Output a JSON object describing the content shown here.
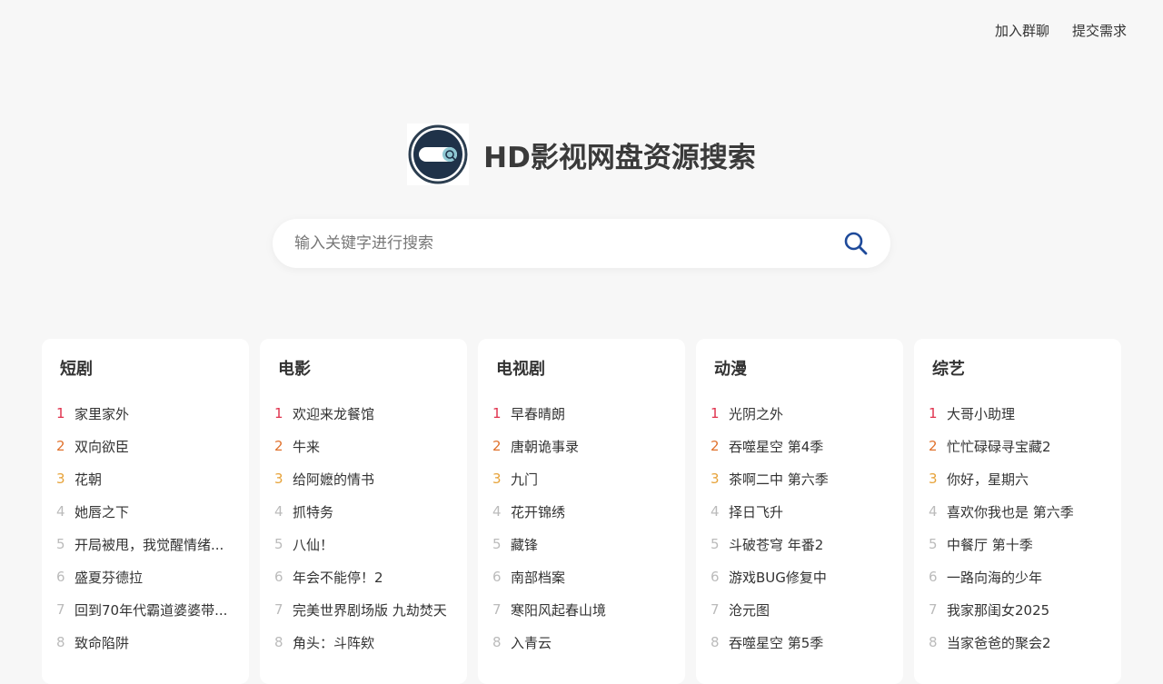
{
  "nav": {
    "join_group": "加入群聊",
    "submit_request": "提交需求"
  },
  "site": {
    "title": "HD影视网盘资源搜索"
  },
  "search": {
    "placeholder": "输入关键字进行搜索"
  },
  "rank_colors": {
    "first": "#e0324d",
    "second": "#e0712c",
    "third": "#e7a33a",
    "rest": "#bbbbbb"
  },
  "categories": [
    {
      "title": "短剧",
      "items": [
        {
          "rank": "1",
          "text": "家里家外"
        },
        {
          "rank": "2",
          "text": "双向欲臣"
        },
        {
          "rank": "3",
          "text": "花朝"
        },
        {
          "rank": "4",
          "text": "她唇之下"
        },
        {
          "rank": "5",
          "text": "开局被甩，我觉醒情绪..."
        },
        {
          "rank": "6",
          "text": "盛夏芬德拉"
        },
        {
          "rank": "7",
          "text": "回到70年代霸道婆婆带..."
        },
        {
          "rank": "8",
          "text": "致命陷阱"
        }
      ]
    },
    {
      "title": "电影",
      "items": [
        {
          "rank": "1",
          "text": "欢迎来龙餐馆"
        },
        {
          "rank": "2",
          "text": "牛来"
        },
        {
          "rank": "3",
          "text": "给阿嬷的情书"
        },
        {
          "rank": "4",
          "text": "抓特务"
        },
        {
          "rank": "5",
          "text": "八仙！"
        },
        {
          "rank": "6",
          "text": "年会不能停！2"
        },
        {
          "rank": "7",
          "text": "完美世界剧场版 九劫焚天"
        },
        {
          "rank": "8",
          "text": "角头：斗阵欸"
        }
      ]
    },
    {
      "title": "电视剧",
      "items": [
        {
          "rank": "1",
          "text": "早春晴朗"
        },
        {
          "rank": "2",
          "text": "唐朝诡事录"
        },
        {
          "rank": "3",
          "text": "九门"
        },
        {
          "rank": "4",
          "text": "花开锦绣"
        },
        {
          "rank": "5",
          "text": "藏锋"
        },
        {
          "rank": "6",
          "text": "南部档案"
        },
        {
          "rank": "7",
          "text": "寒阳风起春山境"
        },
        {
          "rank": "8",
          "text": "入青云"
        }
      ]
    },
    {
      "title": "动漫",
      "items": [
        {
          "rank": "1",
          "text": "光阴之外"
        },
        {
          "rank": "2",
          "text": "吞噬星空 第4季"
        },
        {
          "rank": "3",
          "text": "茶啊二中 第六季"
        },
        {
          "rank": "4",
          "text": "择日飞升"
        },
        {
          "rank": "5",
          "text": "斗破苍穹 年番2"
        },
        {
          "rank": "6",
          "text": "游戏BUG修复中"
        },
        {
          "rank": "7",
          "text": "沧元图"
        },
        {
          "rank": "8",
          "text": "吞噬星空 第5季"
        }
      ]
    },
    {
      "title": "综艺",
      "items": [
        {
          "rank": "1",
          "text": "大哥小助理"
        },
        {
          "rank": "2",
          "text": "忙忙碌碌寻宝藏2"
        },
        {
          "rank": "3",
          "text": "你好，星期六"
        },
        {
          "rank": "4",
          "text": "喜欢你我也是 第六季"
        },
        {
          "rank": "5",
          "text": "中餐厅 第十季"
        },
        {
          "rank": "6",
          "text": "一路向海的少年"
        },
        {
          "rank": "7",
          "text": "我家那闺女2025"
        },
        {
          "rank": "8",
          "text": "当家爸爸的聚会2"
        }
      ]
    }
  ]
}
